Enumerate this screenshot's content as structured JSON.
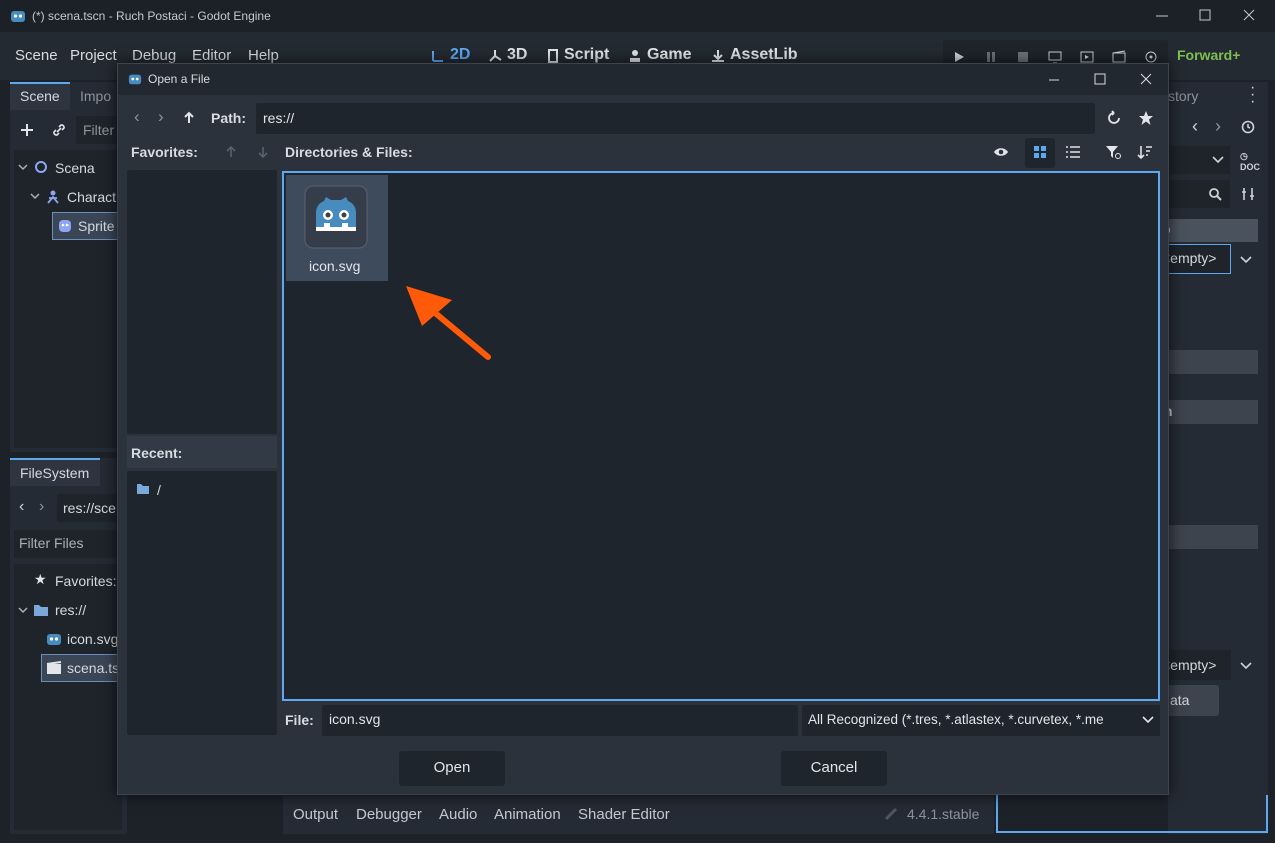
{
  "window": {
    "title": "(*) scena.tscn - Ruch Postaci - Godot Engine"
  },
  "menu": [
    "Scene",
    "Project",
    "Debug",
    "Editor",
    "Help"
  ],
  "workspaces": [
    {
      "label": "2D",
      "icon": "2d-icon"
    },
    {
      "label": "3D",
      "icon": "3d-icon"
    },
    {
      "label": "Script",
      "icon": "script-icon"
    },
    {
      "label": "Game",
      "icon": "game-icon"
    },
    {
      "label": "AssetLib",
      "icon": "assetlib-icon"
    }
  ],
  "renderer": "Forward+",
  "scene_dock": {
    "tabs": [
      "Scene",
      "Impo"
    ],
    "filter_placeholder": "Filter",
    "tree": [
      {
        "label": "Scena",
        "icon": "node2d-icon"
      },
      {
        "label": "Charact",
        "icon": "character-icon"
      },
      {
        "label": "Sprite",
        "icon": "sprite-icon"
      }
    ]
  },
  "filesystem_dock": {
    "tab": "FileSystem",
    "path": "res://sce",
    "filter": "Filter Files",
    "tree": [
      {
        "label": "Favorites:",
        "icon": "star-icon"
      },
      {
        "label": "res://",
        "icon": "folder-icon"
      },
      {
        "label": "icon.svg",
        "icon": "godot-icon"
      },
      {
        "label": "scena.ts",
        "icon": "scene-icon"
      }
    ]
  },
  "inspector": {
    "tab": "story",
    "values": [
      "<empty>",
      "<empty>"
    ],
    "labels": [
      "o",
      "m",
      "ata"
    ]
  },
  "bottom_panel": {
    "tabs": [
      "Output",
      "Debugger",
      "Audio",
      "Animation",
      "Shader Editor"
    ],
    "version": "4.4.1.stable"
  },
  "dialog": {
    "title": "Open a File",
    "path_label": "Path:",
    "path": "res://",
    "favorites_label": "Favorites:",
    "dirs_label": "Directories & Files:",
    "recent_label": "Recent:",
    "recent": [
      "/"
    ],
    "files": [
      {
        "name": "icon.svg",
        "icon": "godot-icon",
        "selected": true
      }
    ],
    "file_label": "File:",
    "file_value": "icon.svg",
    "filter": "All Recognized (*.tres, *.atlastex, *.curvetex, *.me",
    "open_button": "Open",
    "cancel_button": "Cancel"
  },
  "annotation": {
    "color": "#ff5a0a",
    "icon": "arrow-icon"
  }
}
